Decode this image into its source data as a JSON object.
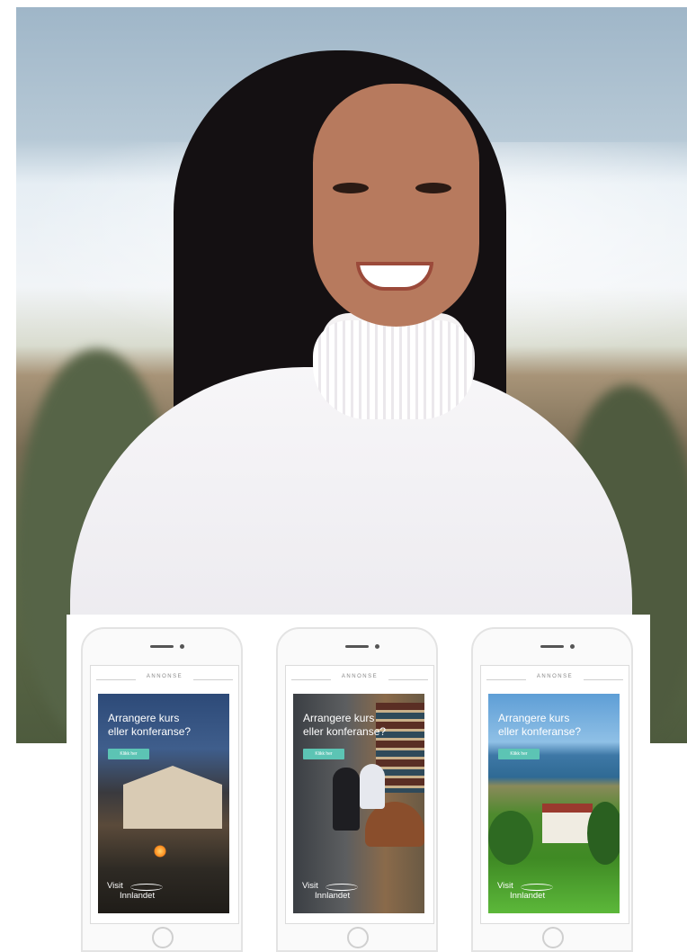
{
  "photo": {
    "alt": "portrait"
  },
  "ads": [
    {
      "label": "ANNONSE",
      "headline_1": "Arrangere kurs",
      "headline_2": "eller konferanse?",
      "cta": "Klikk her",
      "logo_1": "Visit",
      "logo_2": "Innlandet",
      "scene": "evening-house"
    },
    {
      "label": "ANNONSE",
      "headline_1": "Arrangere kurs",
      "headline_2": "eller konferanse?",
      "cta": "Klikk her",
      "logo_1": "Visit",
      "logo_2": "Innlandet",
      "scene": "meeting-room"
    },
    {
      "label": "ANNONSE",
      "headline_1": "Arrangere kurs",
      "headline_2": "eller konferanse?",
      "cta": "Klikk her",
      "logo_1": "Visit",
      "logo_2": "Innlandet",
      "scene": "lake-manor"
    }
  ],
  "colors": {
    "cta": "#5cc4b4",
    "background": "#ffffff"
  }
}
